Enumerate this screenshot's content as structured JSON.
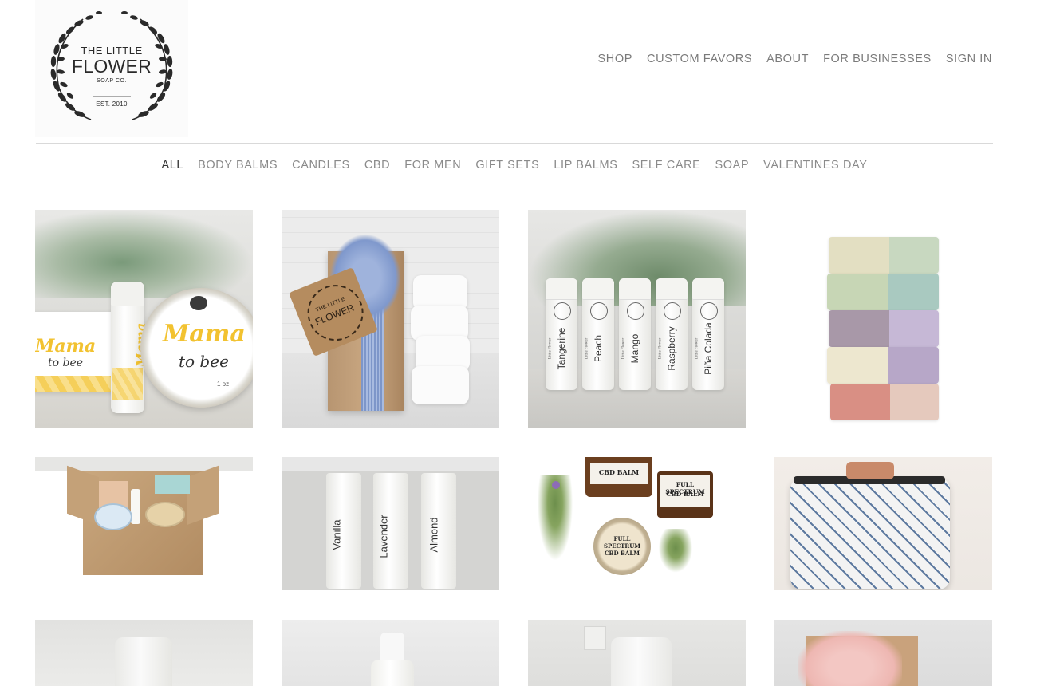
{
  "brand": {
    "line1": "THE LITTLE",
    "line2": "FLOWER",
    "line3": "SOAP CO.",
    "line4": "EST. 2010"
  },
  "main_nav": [
    "SHOP",
    "CUSTOM FAVORS",
    "ABOUT",
    "FOR BUSINESSES",
    "SIGN IN"
  ],
  "categories": {
    "active": "ALL",
    "items": [
      "ALL",
      "BODY BALMS",
      "CANDLES",
      "CBD",
      "FOR MEN",
      "GIFT SETS",
      "LIP BALMS",
      "SELF CARE",
      "SOAP",
      "VALENTINES DAY"
    ]
  },
  "products": {
    "mama": {
      "tin_line1": "Mama",
      "tin_line2": "to bee",
      "tube_line1": "Mama",
      "tube_line2": "to bee",
      "oz": "1 oz"
    },
    "gift": {
      "tag_line1": "THE LITTLE",
      "tag_line2": "FLOWER"
    },
    "lipbalms": {
      "brand": "Little Flower",
      "subtitle": "All Natural Lip Balm",
      "flavors": [
        "Tangerine",
        "Peach",
        "Mango",
        "Raspberry",
        "Piña Colada"
      ]
    },
    "lipbalms2": {
      "flavors": [
        "Vanilla",
        "Lavender",
        "Almond"
      ]
    },
    "cbd": {
      "jar1_line1": "CBD BALM",
      "jar2_line1": "FULL SPECTRUM",
      "jar2_line2": "CBD BALM",
      "tin_line1": "FULL",
      "tin_line2": "SPECTRUM",
      "tin_line3": "CBD BALM"
    }
  },
  "colors": {
    "nav_text": "#7a7a7a",
    "nav_active": "#333333",
    "divider": "#d9d9d9",
    "honey": "#f2c230",
    "soap_pink": "#d98f84",
    "soap_green": "#c7d6b5",
    "soap_purple": "#a898a8"
  }
}
